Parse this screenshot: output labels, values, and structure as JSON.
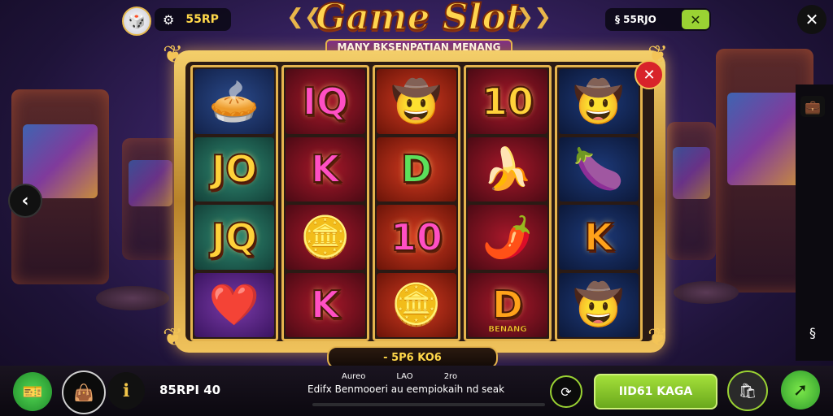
{
  "header": {
    "balance": "55RP",
    "title": "Game Slot",
    "subtitle": "MANY BKSENPATIAN MENANG",
    "right_value": "§ 55RJO"
  },
  "reels": [
    [
      {
        "kind": "icon",
        "icon": "pie-icon",
        "glyph": "🥧",
        "bg": "c-blue"
      },
      {
        "kind": "text",
        "text": "JO",
        "cls": "gold",
        "bg": "c-teal"
      },
      {
        "kind": "text",
        "text": "JQ",
        "cls": "gold",
        "bg": "c-teal"
      },
      {
        "kind": "icon",
        "icon": "heart-icon",
        "glyph": "❤️",
        "bg": "c-purple"
      }
    ],
    [
      {
        "kind": "text",
        "text": "IQ",
        "cls": "pink",
        "bg": "c-darkred"
      },
      {
        "kind": "text",
        "text": "K",
        "cls": "pink",
        "bg": "c-darkred"
      },
      {
        "kind": "icon",
        "icon": "coin-icon",
        "glyph": "🪙",
        "bg": "c-darkred"
      },
      {
        "kind": "text",
        "text": "K",
        "cls": "pink",
        "bg": "c-darkred"
      }
    ],
    [
      {
        "kind": "icon",
        "icon": "hat-icon",
        "glyph": "🤠",
        "bg": "c-red"
      },
      {
        "kind": "text",
        "text": "D",
        "cls": "green",
        "bg": "c-red"
      },
      {
        "kind": "text",
        "text": "10",
        "cls": "pink",
        "bg": "c-red"
      },
      {
        "kind": "icon",
        "icon": "coin-icon",
        "glyph": "🪙",
        "bg": "c-red"
      }
    ],
    [
      {
        "kind": "text",
        "text": "10",
        "cls": "gold",
        "bg": "c-darkred"
      },
      {
        "kind": "icon",
        "icon": "banana-icon",
        "glyph": "🍌",
        "bg": "c-darkred"
      },
      {
        "kind": "icon",
        "icon": "chili-icon",
        "glyph": "🌶️",
        "bg": "c-darkred"
      },
      {
        "kind": "text",
        "text": "D",
        "cls": "orange",
        "bg": "c-darkred",
        "tag": "BENANG"
      }
    ],
    [
      {
        "kind": "icon",
        "icon": "explorer-icon",
        "glyph": "🤠",
        "bg": "c-navy"
      },
      {
        "kind": "icon",
        "icon": "eggplant-icon",
        "glyph": "🍆",
        "bg": "c-navy"
      },
      {
        "kind": "text",
        "text": "K",
        "cls": "orange",
        "bg": "c-navy"
      },
      {
        "kind": "icon",
        "icon": "explorer-icon",
        "glyph": "🤠",
        "bg": "c-navy"
      }
    ]
  ],
  "win_bar": "- 5P6 KO6",
  "bottom": {
    "bet_value": "85RPI 40",
    "labels": [
      "Aureo",
      "LAO",
      "2ro"
    ],
    "message": "Edifx Benmooeri au eempiokaih nd seak",
    "spin_label": "IID61 KAGA"
  },
  "colors": {
    "accent_green": "#86d62c",
    "gold": "#f1c14f",
    "close_red": "#d8232a"
  }
}
